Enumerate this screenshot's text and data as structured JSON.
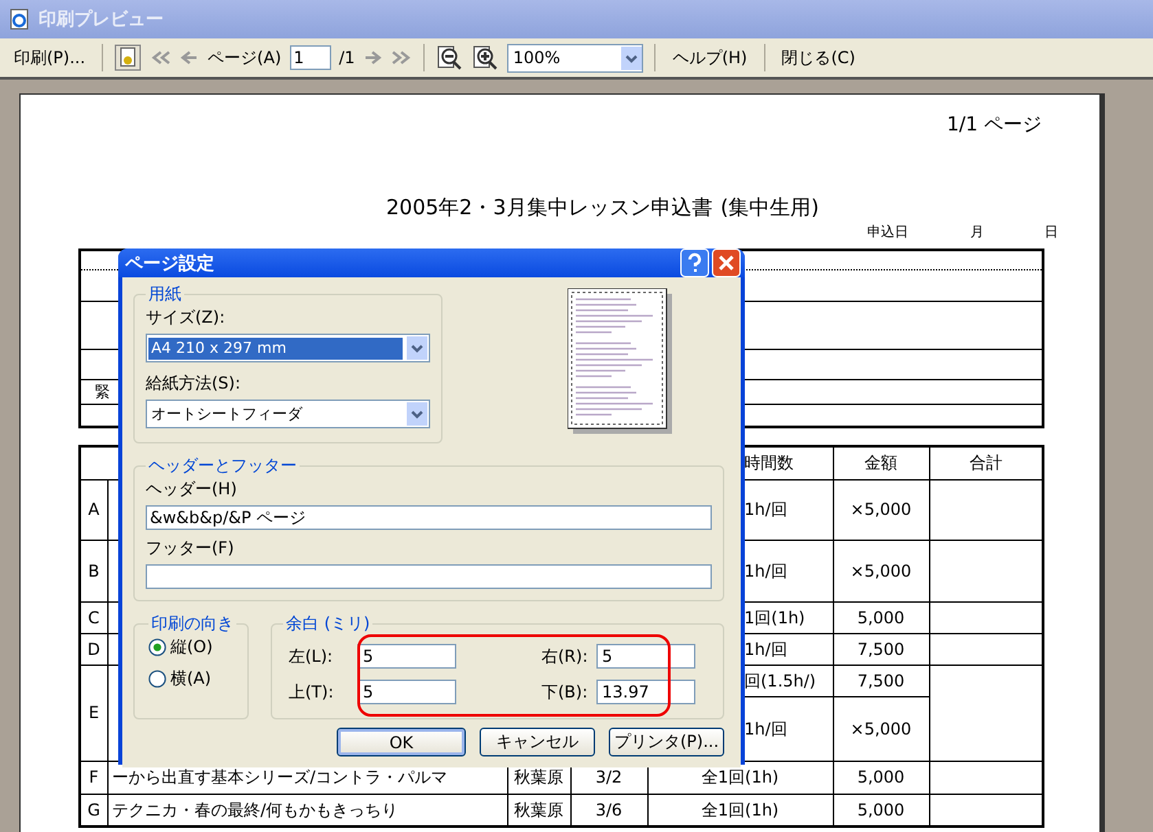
{
  "window": {
    "title": "印刷プレビュー"
  },
  "toolbar": {
    "print": "印刷(P)...",
    "page_label": "ページ(A)",
    "page_value": "1",
    "page_total": "/1",
    "zoom": "100%",
    "help": "ヘルプ(H)",
    "close": "閉じる(C)"
  },
  "document": {
    "page_number": "1/1 ページ",
    "title": "2005年2・3月集中レッスン申込書",
    "subtitle": "(集中生用)",
    "date_labels": [
      "申込日",
      "月",
      "日"
    ],
    "side_label": "緊",
    "header": [
      "時間数",
      "金額",
      "合計"
    ],
    "rows": [
      {
        "letter": "A",
        "lines": [
          {
            "times": "1h/回",
            "amount": "×5,000"
          }
        ]
      },
      {
        "letter": "B",
        "lines": [
          {
            "times": "1h/回",
            "amount": "×5,000"
          }
        ]
      },
      {
        "letter": "C",
        "lines": [
          {
            "times": "1回(1h)",
            "amount": "5,000"
          }
        ]
      },
      {
        "letter": "D",
        "lines": [
          {
            "times": "1h/回",
            "amount": "7,500"
          }
        ]
      },
      {
        "letter": "E",
        "lines": [
          {
            "times": "回(1.5h/)",
            "amount": "7,500"
          },
          {
            "times": "1h/回",
            "amount": "×5,000"
          }
        ]
      },
      {
        "letter": "F",
        "course": "ーから出直す基本シリーズ/コントラ・パルマ",
        "place": "秋葉原",
        "date": "3/2",
        "lines": [
          {
            "times": "全1回(1h)",
            "amount": "5,000"
          }
        ]
      },
      {
        "letter": "G",
        "course": "テクニカ・春の最終/何もかもきっちり",
        "place": "秋葉原",
        "date": "3/6",
        "lines": [
          {
            "times": "全1回(1h)",
            "amount": "5,000"
          }
        ]
      }
    ]
  },
  "dialog": {
    "title": "ページ設定",
    "paper": {
      "legend": "用紙",
      "size_label": "サイズ(Z):",
      "size_value": "A4 210 x 297 mm",
      "source_label": "給紙方法(S):",
      "source_value": "オートシートフィーダ"
    },
    "header_footer": {
      "legend": "ヘッダーとフッター",
      "header_label": "ヘッダー(H)",
      "header_value": "&w&b&p/&P ページ",
      "footer_label": "フッター(F)"
    },
    "orientation": {
      "legend": "印刷の向き",
      "options": [
        {
          "label": "縦(O)",
          "selected": true
        },
        {
          "label": "横(A)",
          "selected": false
        }
      ]
    },
    "margins": {
      "legend": "余白 (ミリ)",
      "fields": [
        {
          "label": "左(L):",
          "value": "5"
        },
        {
          "label": "右(R):",
          "value": "5"
        },
        {
          "label": "上(T):",
          "value": "5"
        },
        {
          "label": "下(B):",
          "value": "13.97"
        }
      ]
    },
    "buttons": [
      "OK",
      "キャンセル",
      "プリンタ(P)..."
    ]
  }
}
